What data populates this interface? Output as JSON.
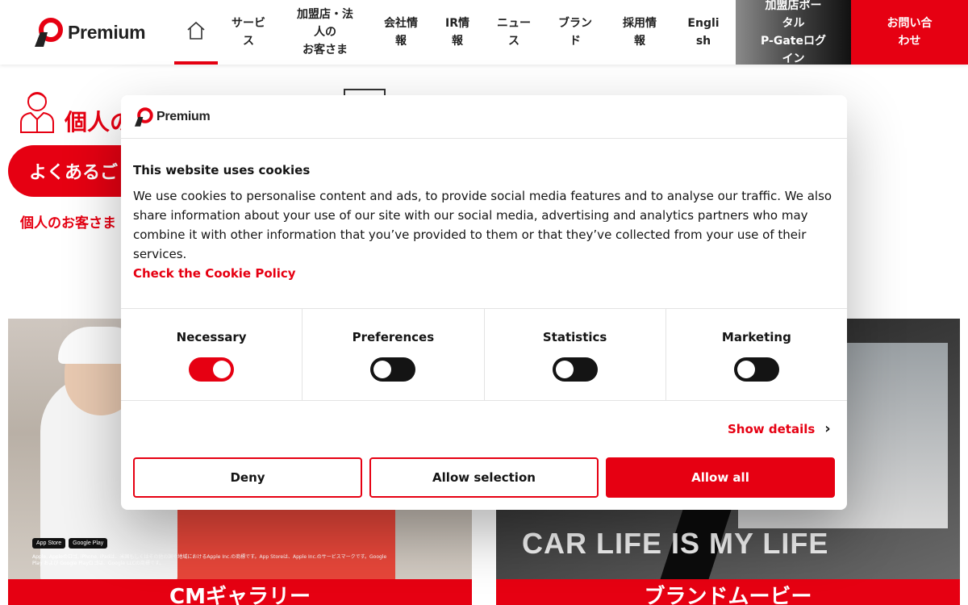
{
  "header": {
    "logo_text": "Premium",
    "nav": [
      {
        "label": "サービ\nス"
      },
      {
        "label": "加盟店・法\n人の\nお客さま"
      },
      {
        "label": "会社情\n報"
      },
      {
        "label": "IR情\n報"
      },
      {
        "label": "ニュー\nス"
      },
      {
        "label": "ブラン\nド"
      },
      {
        "label": "採用情\n報"
      },
      {
        "label": "Engli\nsh"
      }
    ],
    "portal_label": "加盟店ポー\nタル\nP-Gateログ\nイン",
    "contact_label": "お問い合\nわせ"
  },
  "page": {
    "heading_visible": "個人の",
    "faq_button": "よくあるご",
    "red_link": "個人のお客さま",
    "cards": [
      {
        "caption": "CMギャラリー",
        "badges": [
          "App Store",
          "Google Play"
        ],
        "fine_print": "Apple, Appleのロゴ, iPhone, iPadは、米国もしくはその他の国や地域におけるApple Inc.の商標です。App Storeは、Apple Inc.のサービスマークです。Google Play および Google Playロゴは、Google LLCの商標です。"
      },
      {
        "caption": "ブランドムービー",
        "slogan": "CAR LIFE IS MY LIFE"
      }
    ]
  },
  "cookie_dialog": {
    "logo_text": "Premium",
    "title": "This website uses cookies",
    "body": "We use cookies to personalise content and ads, to provide social media features and to analyse our traffic. We also share information about your use of our site with our social media, advertising and analytics partners who may combine it with other information that you’ve provided to them or that they’ve collected from your use of their services.",
    "policy_link": "Check the Cookie Policy",
    "toggles": [
      {
        "label": "Necessary",
        "checked": true
      },
      {
        "label": "Preferences",
        "checked": false
      },
      {
        "label": "Statistics",
        "checked": false
      },
      {
        "label": "Marketing",
        "checked": false
      }
    ],
    "show_details": "Show details",
    "buttons": {
      "deny": "Deny",
      "allow_selection": "Allow selection",
      "allow_all": "Allow all"
    }
  },
  "colors": {
    "brand_red": "#e60012",
    "text_dark": "#141414"
  }
}
